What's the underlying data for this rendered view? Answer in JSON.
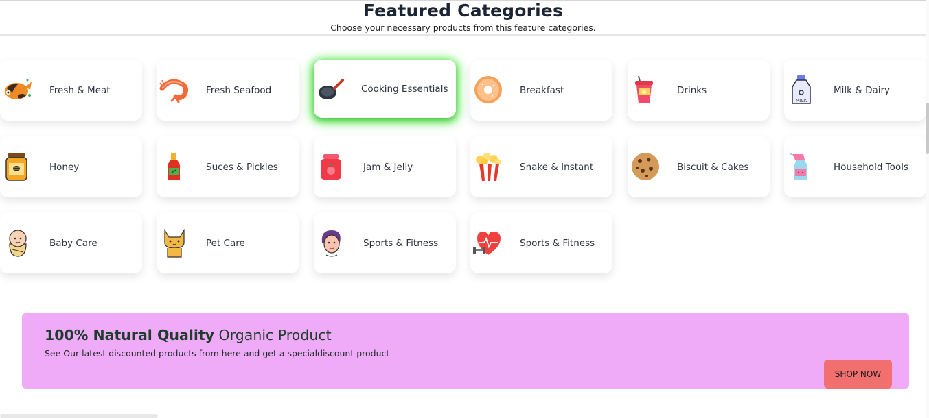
{
  "header": {
    "title": "Featured Categories",
    "subtitle": "Choose your necessary products from this feature categories."
  },
  "categories": [
    {
      "label": "Fresh & Meat",
      "icon": "fish-icon"
    },
    {
      "label": "Fresh Seafood",
      "icon": "shrimp-icon"
    },
    {
      "label": "Cooking Essentials",
      "icon": "frying-pan-icon",
      "state": "hover-highlighted"
    },
    {
      "label": "Breakfast",
      "icon": "donut-icon"
    },
    {
      "label": "Drinks",
      "icon": "drink-cup-icon"
    },
    {
      "label": "Milk & Dairy",
      "icon": "milk-bottle-icon"
    },
    {
      "label": "Honey",
      "icon": "honey-jar-icon"
    },
    {
      "label": "Suces & Pickles",
      "icon": "sauce-bottle-icon"
    },
    {
      "label": "Jam & Jelly",
      "icon": "jam-jar-icon"
    },
    {
      "label": "Snake & Instant",
      "icon": "popcorn-icon"
    },
    {
      "label": "Biscuit & Cakes",
      "icon": "cookie-icon"
    },
    {
      "label": "Household Tools",
      "icon": "spray-bottle-icon"
    },
    {
      "label": "Baby Care",
      "icon": "baby-icon"
    },
    {
      "label": "Pet Care",
      "icon": "cat-icon"
    },
    {
      "label": "Sports & Fitness",
      "icon": "person-face-icon"
    },
    {
      "label": "Sports & Fitness",
      "icon": "heart-dumbbell-icon"
    }
  ],
  "banner": {
    "heading_bold": "100% Natural Quality",
    "heading_rest": " Organic Product",
    "description": "See Our latest discounted products from here and get a specialdiscount product",
    "button_label": "SHOP NOW"
  },
  "colors": {
    "banner_bg": "#efabf8",
    "button_bg": "#f26f6f",
    "hover_glow": "#2de61e"
  }
}
